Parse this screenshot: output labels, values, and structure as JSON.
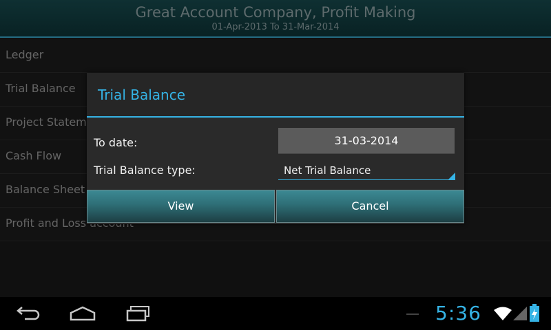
{
  "header": {
    "title": "Great Account Company, Profit Making",
    "period": "01-Apr-2013 To 31-Mar-2014"
  },
  "menu": {
    "items": [
      {
        "label": "Ledger"
      },
      {
        "label": "Trial Balance"
      },
      {
        "label": "Project Statem"
      },
      {
        "label": "Cash Flow"
      },
      {
        "label": "Balance Sheet"
      },
      {
        "label": "Profit and Loss account"
      }
    ]
  },
  "dialog": {
    "title": "Trial Balance",
    "to_date_label": "To date:",
    "to_date_value": "31-03-2014",
    "type_label": "Trial Balance type:",
    "type_value": "Net Trial Balance",
    "view_label": "View",
    "cancel_label": "Cancel"
  },
  "system_bar": {
    "time": "5:36",
    "icons": [
      "back-icon",
      "home-icon",
      "recent-apps-icon",
      "wifi-icon",
      "signal-icon",
      "battery-charging-icon"
    ]
  },
  "colors": {
    "accent": "#35b3e5",
    "header_bg": "#174a4e",
    "button_bg": "#2e6e76"
  }
}
